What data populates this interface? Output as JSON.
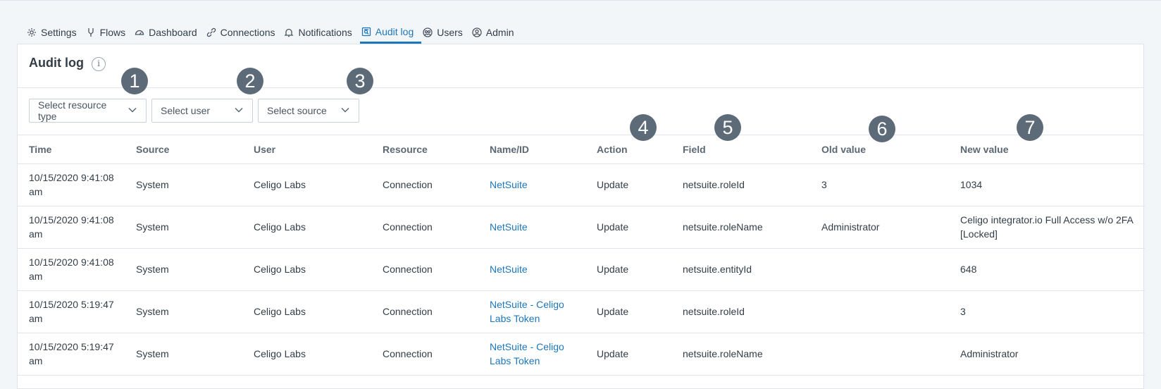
{
  "tabs": [
    {
      "label": "Settings",
      "icon": "gear-icon"
    },
    {
      "label": "Flows",
      "icon": "flows-icon"
    },
    {
      "label": "Dashboard",
      "icon": "dashboard-icon"
    },
    {
      "label": "Connections",
      "icon": "connections-icon"
    },
    {
      "label": "Notifications",
      "icon": "bell-icon"
    },
    {
      "label": "Audit log",
      "icon": "audit-log-icon",
      "active": true
    },
    {
      "label": "Users",
      "icon": "users-icon"
    },
    {
      "label": "Admin",
      "icon": "admin-icon"
    }
  ],
  "panel": {
    "title": "Audit log",
    "info_glyph": "i"
  },
  "filters": {
    "resource_type": "Select resource type",
    "user": "Select user",
    "source": "Select source"
  },
  "table": {
    "headers": [
      "Time",
      "Source",
      "User",
      "Resource",
      "Name/ID",
      "Action",
      "Field",
      "Old value",
      "New value"
    ],
    "rows": [
      {
        "time": "10/15/2020 9:41:08 am",
        "source": "System",
        "user": "Celigo Labs",
        "resource": "Connection",
        "name": "NetSuite",
        "action": "Update",
        "field": "netsuite.roleId",
        "old": "3",
        "new": "1034"
      },
      {
        "time": "10/15/2020 9:41:08 am",
        "source": "System",
        "user": "Celigo Labs",
        "resource": "Connection",
        "name": "NetSuite",
        "action": "Update",
        "field": "netsuite.roleName",
        "old": "Administrator",
        "new": "Celigo integrator.io Full Access w/o 2FA [Locked]"
      },
      {
        "time": "10/15/2020 9:41:08 am",
        "source": "System",
        "user": "Celigo Labs",
        "resource": "Connection",
        "name": "NetSuite",
        "action": "Update",
        "field": "netsuite.entityId",
        "old": "",
        "new": "648"
      },
      {
        "time": "10/15/2020 5:19:47 am",
        "source": "System",
        "user": "Celigo Labs",
        "resource": "Connection",
        "name": "NetSuite - Celigo Labs Token",
        "action": "Update",
        "field": "netsuite.roleId",
        "old": "",
        "new": "3"
      },
      {
        "time": "10/15/2020 5:19:47 am",
        "source": "System",
        "user": "Celigo Labs",
        "resource": "Connection",
        "name": "NetSuite - Celigo Labs Token",
        "action": "Update",
        "field": "netsuite.roleName",
        "old": "",
        "new": "Administrator"
      }
    ]
  },
  "markers": [
    "1",
    "2",
    "3",
    "4",
    "5",
    "6",
    "7"
  ],
  "colors": {
    "accent": "#1d76ba",
    "marker": "#5d6b78"
  }
}
